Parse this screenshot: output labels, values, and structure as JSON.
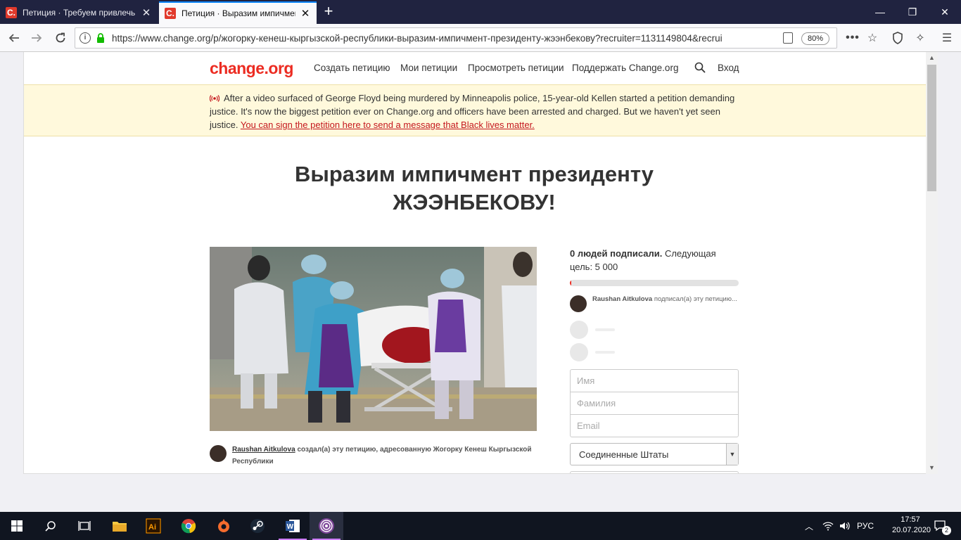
{
  "browser": {
    "tabs": [
      {
        "title": "Петиция · Требуем привлечь",
        "favicon": "C."
      },
      {
        "title": "Петиция · Выразим импичмен",
        "favicon": "C."
      }
    ],
    "url": "https://www.change.org/p/жогорку-кенеш-кыргызской-республики-выразим-импичмент-президенту-жээнбекову?recruiter=1131149804&recrui",
    "zoom": "80%"
  },
  "site": {
    "logo": "change.org",
    "nav": [
      "Создать петицию",
      "Мои петиции",
      "Просмотреть петиции",
      "Поддержать Change.org",
      "Вход"
    ]
  },
  "alert": {
    "text": "After a video surfaced of George Floyd being murdered by Minneapolis police, 15-year-old Kellen started a petition demanding justice. It's now the biggest petition ever on Change.org and officers have been arrested and charged. But we haven't yet seen justice.",
    "link": "You can sign the petition here to send a message that Black lives matter."
  },
  "petition": {
    "title_line1": "Выразим импичмент президенту",
    "title_line2": "ЖЭЭНБЕКОВУ!",
    "author_name": "Raushan Aitkulova",
    "author_text": "создал(а) эту петицию, адресованную Жогорку Кенеш Кыргызской Республики"
  },
  "sidebar": {
    "signed_count": "0 людей подписали.",
    "goal_text": "Следующая цель: 5 000",
    "progress_fraction": 0.005,
    "recent_name": "Raushan Aitkulova",
    "recent_text": "подписал(а) эту петицию...",
    "fields": {
      "first_name": "Имя",
      "last_name": "Фамилия",
      "email": "Email"
    },
    "country": "Соединенные Штаты"
  },
  "taskbar": {
    "lang": "РУС",
    "time": "17:57",
    "date": "20.07.2020",
    "notifications": "2"
  },
  "colors": {
    "brand": "#ec2c22",
    "alert_bg": "#fff9dc",
    "tabbar": "#202340",
    "taskbar": "#101520"
  }
}
